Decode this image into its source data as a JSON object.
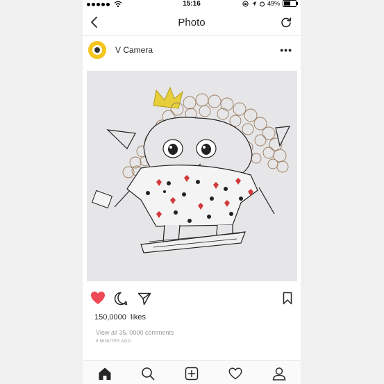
{
  "status_bar": {
    "time": "15:16",
    "battery": "49%",
    "battery_level": 0.49
  },
  "nav": {
    "title": "Photo",
    "back_icon": "chevron-left-icon",
    "refresh_icon": "refresh-icon"
  },
  "post": {
    "username": "V Camera",
    "more_icon": "more-horizontal-icon",
    "liked": true,
    "likes_count": "150,0000",
    "likes_label": "likes",
    "comments_text": "View all 35, 0000 comments",
    "time_ago": "9 MINUTES AGO"
  },
  "tabs": [
    "home-icon",
    "search-icon",
    "add-post-icon",
    "activity-heart-icon",
    "profile-icon"
  ],
  "colors": {
    "like_red": "#ed4956",
    "avatar_yellow": "#f6c51c",
    "text": "#262626",
    "muted": "#9a9a9a"
  }
}
